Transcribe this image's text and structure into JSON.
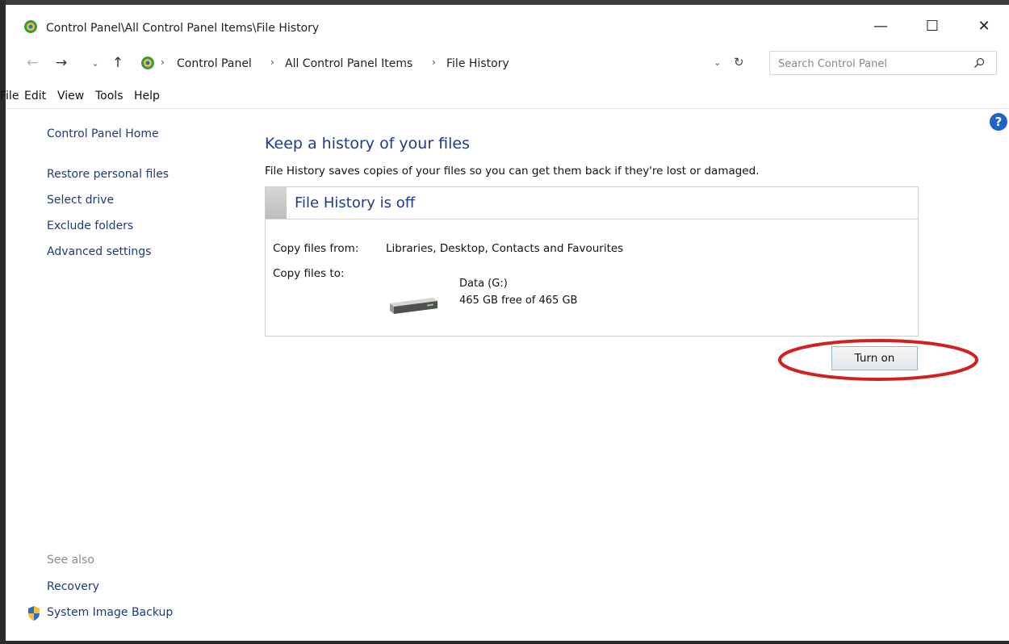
{
  "window": {
    "title": "Control Panel\\All Control Panel Items\\File History",
    "controls": {
      "minimize": "—",
      "maximize": "☐",
      "close": "✕"
    }
  },
  "nav": {
    "back": "←",
    "forward": "→",
    "recent": "⌄",
    "up": "↑"
  },
  "address": {
    "separator": "›",
    "crumbs": [
      "Control Panel",
      "All Control Panel Items",
      "File History"
    ],
    "dropdown": "⌄",
    "refresh": "↻"
  },
  "search": {
    "placeholder": "Search Control Panel"
  },
  "menu": [
    "File",
    "Edit",
    "View",
    "Tools",
    "Help"
  ],
  "help_glyph": "?",
  "sidebar": {
    "home": "Control Panel Home",
    "links": [
      "Restore personal files",
      "Select drive",
      "Exclude folders",
      "Advanced settings"
    ],
    "see_also_label": "See also",
    "see_also": [
      "Recovery",
      "System Image Backup"
    ]
  },
  "main": {
    "heading": "Keep a history of your files",
    "description": "File History saves copies of your files so you can get them back if they're lost or damaged.",
    "status_title": "File History is off",
    "copy_from_label": "Copy files from:",
    "copy_from_value": "Libraries, Desktop, Contacts and Favourites",
    "copy_to_label": "Copy files to:",
    "drive_name": "Data (G:)",
    "drive_space": "465 GB free of 465 GB",
    "turn_on_label": "Turn on"
  },
  "colors": {
    "link": "#1e3b78",
    "heading": "#1e3b8f",
    "help": "#1f63c7",
    "annotation": "#d21f1f"
  },
  "icons": {
    "title": "control-panel-icon",
    "address": "control-panel-icon",
    "search": "search-icon",
    "help": "help-icon",
    "drive": "hard-drive-icon",
    "see_also_system_image": "shield-icon"
  }
}
